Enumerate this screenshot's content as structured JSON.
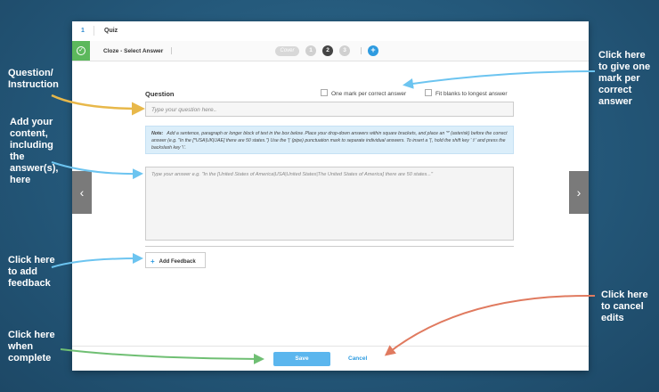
{
  "topbar": {
    "number": "1",
    "title": "Quiz"
  },
  "section": {
    "label": "Cloze - Select Answer",
    "cover_label": "Cover",
    "steps": [
      "1",
      "2",
      "3"
    ],
    "active_step": "2",
    "add_label": "+"
  },
  "question": {
    "label": "Question",
    "option_one_mark": "One mark per correct answer",
    "option_fit_blanks": "Fit blanks to longest answer",
    "placeholder": "Type your question here.."
  },
  "note": {
    "label": "Note:",
    "text": "Add a sentence, paragraph or longer block of text in the box below. Place your drop-down answers within square brackets, and place an '*' (asterisk) before the correct answer (e.g. \"In the [*USA|UK|UAE] there are 50 states.\") Use the '|' (pipe) punctuation mark to separate individual answers. To insert a '|', hold the shift key '⇧' and press the backslash key '\\'."
  },
  "answer": {
    "placeholder": "Type your answer e.g. \"In the [United States of America|USA|United States|The United States of America] there are 50 states...\""
  },
  "feedback": {
    "icon": "+",
    "label": "Add Feedback"
  },
  "footer": {
    "save_label": "Save",
    "cancel_label": "Cancel"
  },
  "nav": {
    "prev": "‹",
    "next": "›"
  },
  "annotations": {
    "question": "Question/ Instruction",
    "content": "Add your content, including the answer(s), here",
    "feedback": "Click here to add feedback",
    "complete": "Click here when complete",
    "one_mark": "Click here to give one mark per correct answer",
    "cancel": "Click here to cancel edits"
  },
  "colors": {
    "background": "#24587a",
    "accent": "#2e9be0",
    "save": "#5bb6ee",
    "arrow_yellow": "#e8b84a",
    "arrow_blue": "#6cc4f0",
    "arrow_green": "#6fbf73",
    "arrow_red": "#e07a5f",
    "check": "#5cb85c"
  }
}
